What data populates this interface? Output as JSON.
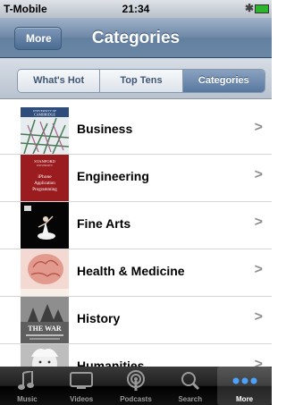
{
  "status": {
    "carrier": "T-Mobile",
    "time": "21:34"
  },
  "nav": {
    "back_label": "More",
    "title": "Categories"
  },
  "segments": [
    {
      "label": "What's Hot",
      "active": false
    },
    {
      "label": "Top Tens",
      "active": false
    },
    {
      "label": "Categories",
      "active": true
    }
  ],
  "categories": [
    {
      "label": "Business",
      "thumb_text": "UNIVERSITY OF CAMBRIDGE"
    },
    {
      "label": "Engineering",
      "thumb_text": "STANFORD iPhone Application Programming"
    },
    {
      "label": "Fine Arts",
      "thumb_text": ""
    },
    {
      "label": "Health & Medicine",
      "thumb_text": ""
    },
    {
      "label": "History",
      "thumb_text": "THE WAR"
    },
    {
      "label": "Humanities",
      "thumb_text": ""
    }
  ],
  "tabs": [
    {
      "label": "Music",
      "icon": "music-icon",
      "active": false
    },
    {
      "label": "Videos",
      "icon": "videos-icon",
      "active": false
    },
    {
      "label": "Podcasts",
      "icon": "podcasts-icon",
      "active": false
    },
    {
      "label": "Search",
      "icon": "search-icon",
      "active": false
    },
    {
      "label": "More",
      "icon": "more-icon",
      "active": true
    }
  ],
  "colors": {
    "nav": "#6e87a6",
    "active_segment": "#5878a0",
    "tabbar": "#111111"
  }
}
